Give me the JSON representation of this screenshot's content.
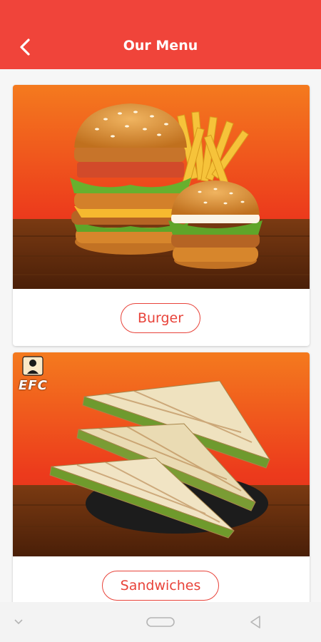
{
  "header": {
    "title": "Our Menu",
    "back_icon": "chevron-left-icon",
    "color": "#f0443a"
  },
  "categories": [
    {
      "label": "Burger",
      "image": "burger-combo-image"
    },
    {
      "label": "Sandwiches",
      "image": "grilled-sandwich-image",
      "logo_text": "EFC"
    }
  ],
  "colors": {
    "accent": "#e8433a",
    "image_background": "#f26a1f"
  },
  "system_nav": {
    "icons": [
      "chevron-down-icon",
      "home-pill-icon",
      "back-triangle-icon"
    ]
  }
}
